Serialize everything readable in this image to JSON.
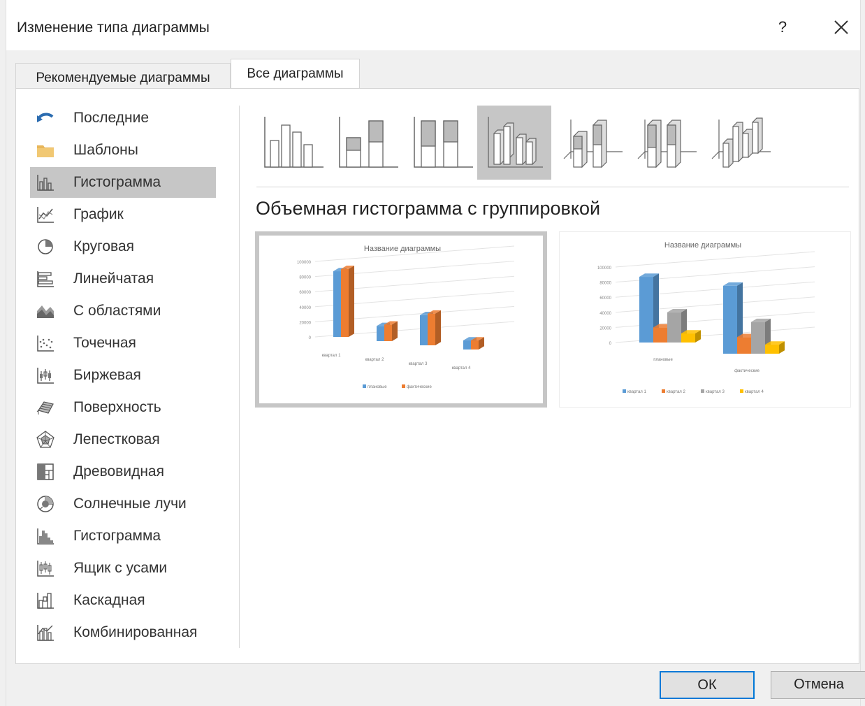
{
  "dialog": {
    "title": "Изменение типа диаграммы",
    "help": "?"
  },
  "tabs": [
    {
      "label": "Рекомендуемые диаграммы",
      "active": false
    },
    {
      "label": "Все диаграммы",
      "active": true
    }
  ],
  "sidebar": {
    "items": [
      {
        "label": "Последние",
        "icon": "recent-icon"
      },
      {
        "label": "Шаблоны",
        "icon": "folder-icon"
      },
      {
        "label": "Гистограмма",
        "icon": "column-chart-icon",
        "selected": true
      },
      {
        "label": "График",
        "icon": "line-chart-icon"
      },
      {
        "label": "Круговая",
        "icon": "pie-chart-icon"
      },
      {
        "label": "Линейчатая",
        "icon": "bar-chart-icon"
      },
      {
        "label": "С областями",
        "icon": "area-chart-icon"
      },
      {
        "label": "Точечная",
        "icon": "scatter-chart-icon"
      },
      {
        "label": "Биржевая",
        "icon": "stock-chart-icon"
      },
      {
        "label": "Поверхность",
        "icon": "surface-chart-icon"
      },
      {
        "label": "Лепестковая",
        "icon": "radar-chart-icon"
      },
      {
        "label": "Древовидная",
        "icon": "treemap-chart-icon"
      },
      {
        "label": "Солнечные лучи",
        "icon": "sunburst-chart-icon"
      },
      {
        "label": "Гистограмма",
        "icon": "histogram-chart-icon"
      },
      {
        "label": "Ящик с усами",
        "icon": "box-whisker-chart-icon"
      },
      {
        "label": "Каскадная",
        "icon": "waterfall-chart-icon"
      },
      {
        "label": "Комбинированная",
        "icon": "combo-chart-icon"
      }
    ]
  },
  "subtypes": {
    "selected_index": 3,
    "selected_title": "Объемная гистограмма с группировкой"
  },
  "previews": [
    {
      "title": "Название диаграммы",
      "selected": true,
      "chart_data": {
        "type": "bar",
        "title": "Название диаграммы",
        "categories": [
          "квартал 1",
          "квартал 2",
          "квартал 3",
          "квартал 4"
        ],
        "series": [
          {
            "name": "плановые",
            "values": [
              87000,
              20000,
              40000,
              12000
            ]
          },
          {
            "name": "фактические",
            "values": [
              90000,
              22000,
              42000,
              12000
            ]
          }
        ],
        "yticks": [
          "100000",
          "80000",
          "60000",
          "40000",
          "20000",
          "0"
        ],
        "ylim": [
          0,
          100000
        ],
        "legend_position": "bottom"
      }
    },
    {
      "title": "Название диаграммы",
      "selected": false,
      "chart_data": {
        "type": "bar",
        "title": "Название диаграммы",
        "categories": [
          "плановые",
          "фактические"
        ],
        "series": [
          {
            "name": "квартал 1",
            "values": [
              87000,
              90000
            ]
          },
          {
            "name": "квартал 2",
            "values": [
              20000,
              22000
            ]
          },
          {
            "name": "квартал 3",
            "values": [
              40000,
              42000
            ]
          },
          {
            "name": "квартал 4",
            "values": [
              12000,
              12000
            ]
          }
        ],
        "yticks": [
          "100000",
          "80000",
          "60000",
          "40000",
          "20000",
          "0"
        ],
        "ylim": [
          0,
          100000
        ],
        "legend_position": "bottom"
      }
    }
  ],
  "colors": {
    "blue": "#5b9bd5",
    "orange": "#ed7d31",
    "gray": "#a5a5a5",
    "yellow": "#ffc000",
    "selection": "#c6c6c6",
    "ok_border": "#0078d7"
  },
  "buttons": {
    "ok": "ОК",
    "cancel": "Отмена"
  }
}
